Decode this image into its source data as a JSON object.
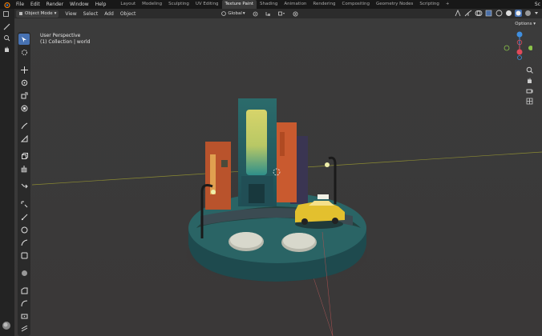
{
  "topbar": {
    "menus": [
      "File",
      "Edit",
      "Render",
      "Window",
      "Help"
    ],
    "workspaces": [
      "Layout",
      "Modeling",
      "Sculpting",
      "UV Editing",
      "Texture Paint",
      "Shading",
      "Animation",
      "Rendering",
      "Compositing",
      "Geometry Nodes",
      "Scripting"
    ],
    "active_workspace": "Texture Paint",
    "add_tab": "+",
    "scene_label": "Sc"
  },
  "header": {
    "mode": "Object Mode",
    "menus": [
      "View",
      "Select",
      "Add",
      "Object"
    ],
    "transform_orientation": "Global"
  },
  "viewport": {
    "perspective": "User Perspective",
    "collection": "(1) Collection | world",
    "options_label": "Options"
  },
  "colors": {
    "active_tool": "#4772b3",
    "viewport_bg": "#3d3d3d",
    "x_axis": "#e04a5a",
    "y_axis": "#8bc34a",
    "z_axis": "#3f8fe0"
  },
  "icons": {
    "tools": [
      "select-box-icon",
      "cursor-icon",
      "move-icon",
      "rotate-icon",
      "scale-icon",
      "transform-icon",
      "annotate-icon",
      "measure-icon",
      "add-cube-icon",
      "extrude-icon",
      "inset-icon",
      "bevel-icon",
      "loop-cut-icon",
      "knife-icon",
      "poly-build-icon",
      "spin-icon",
      "smooth-icon",
      "edge-slide-icon",
      "shrink-icon",
      "shear-icon",
      "rip-icon"
    ],
    "nav": [
      "zoom-icon",
      "pan-hand-icon",
      "camera-icon",
      "grid-icon"
    ]
  }
}
